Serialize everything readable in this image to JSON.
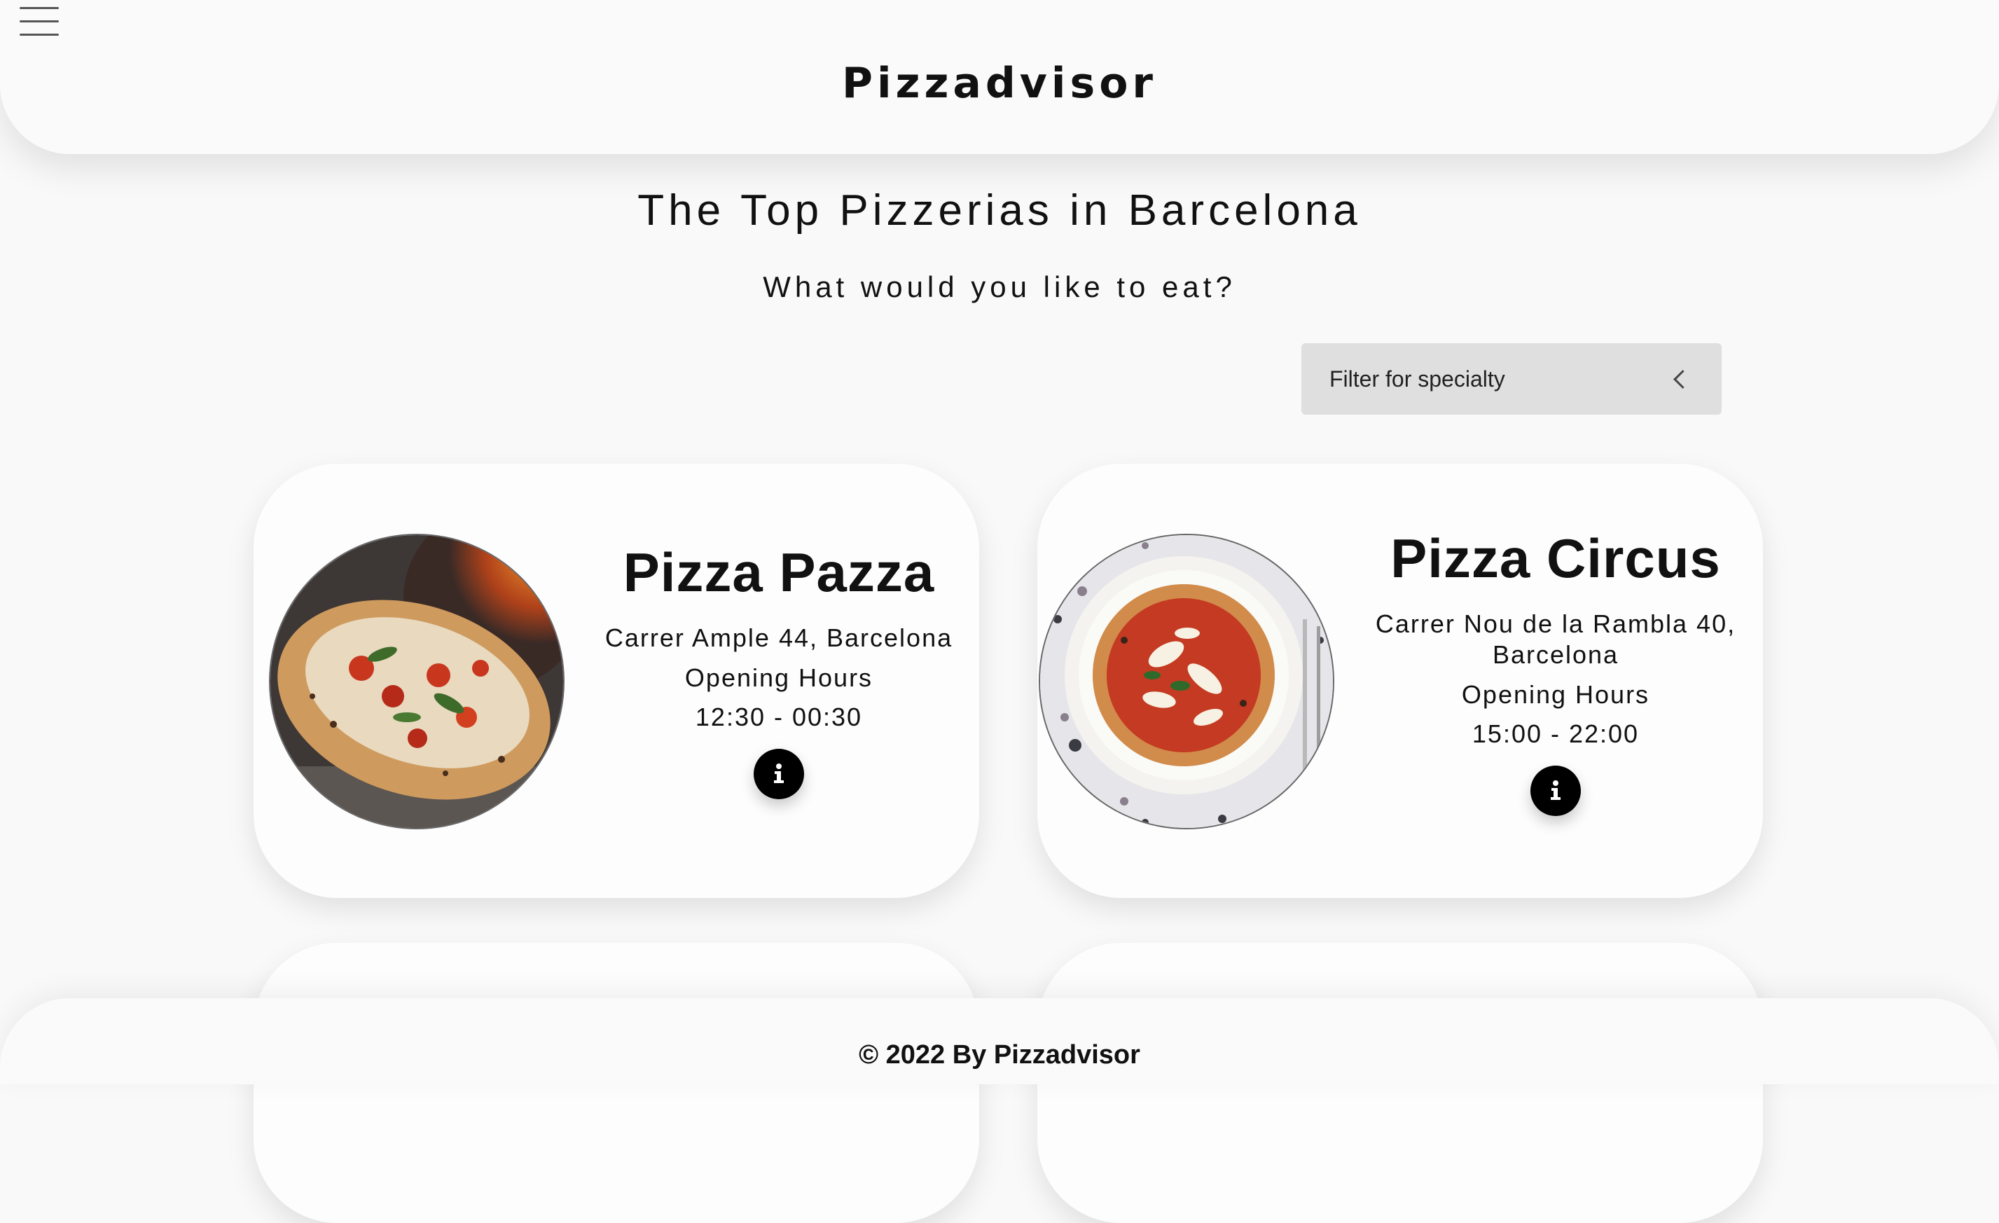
{
  "header": {
    "app_title": "Pizzadvisor"
  },
  "main": {
    "title": "The Top Pizzerias in Barcelona",
    "subtitle": "What would you like to eat?",
    "filter": {
      "label": "Filter for specialty"
    }
  },
  "pizzerias": [
    {
      "name": "Pizza Pazza",
      "address": "Carrer Ample 44, Barcelona",
      "hours_label": "Opening Hours",
      "hours": "12:30 - 00:30"
    },
    {
      "name": "Pizza Circus",
      "address": "Carrer Nou de la Rambla 40, Barcelona",
      "hours_label": "Opening Hours",
      "hours": "15:00 - 22:00"
    }
  ],
  "footer": {
    "text": "© 2022 By Pizzadvisor"
  },
  "colors": {
    "background": "#f9f9f9",
    "filter_bg": "#dfdfdf",
    "info_button": "#000000"
  }
}
